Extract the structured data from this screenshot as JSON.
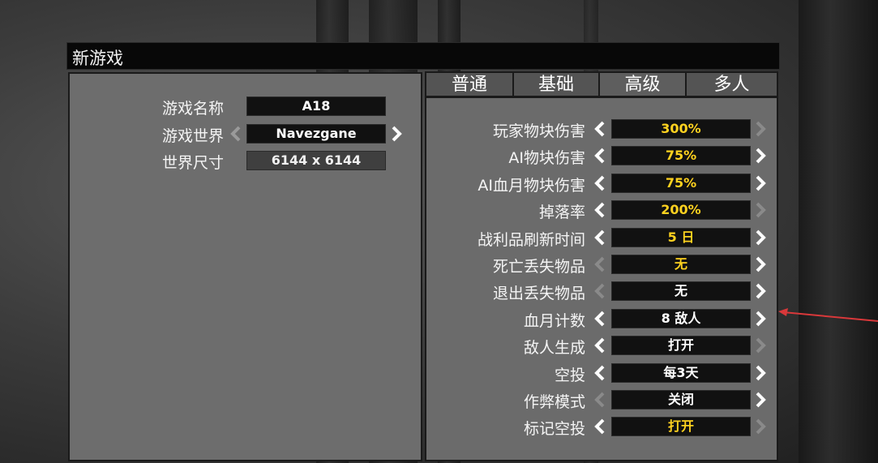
{
  "window": {
    "title": "新游戏"
  },
  "left": {
    "rows": [
      {
        "label": "游戏名称",
        "value": "A18"
      },
      {
        "label": "游戏世界",
        "value": "Navezgane"
      },
      {
        "label": "世界尺寸",
        "value": "6144 x 6144"
      }
    ]
  },
  "tabs": [
    {
      "label": "普通"
    },
    {
      "label": "基础"
    },
    {
      "label": "高级"
    },
    {
      "label": "多人"
    }
  ],
  "settings": [
    {
      "label": "玩家物块伤害",
      "value": "300%"
    },
    {
      "label": "AI物块伤害",
      "value": "75%"
    },
    {
      "label": "AI血月物块伤害",
      "value": "75%"
    },
    {
      "label": "掉落率",
      "value": "200%"
    },
    {
      "label": "战利品刷新时间",
      "value": "5 日"
    },
    {
      "label": "死亡丢失物品",
      "value": "无"
    },
    {
      "label": "退出丢失物品",
      "value": "无"
    },
    {
      "label": "血月计数",
      "value": "8 敌人"
    },
    {
      "label": "敌人生成",
      "value": "打开"
    },
    {
      "label": "空投",
      "value": "每3天"
    },
    {
      "label": "作弊模式",
      "value": "关闭"
    },
    {
      "label": "标记空投",
      "value": "打开"
    }
  ],
  "colors": {
    "highlight": "#ffd21f",
    "normal": "#ffffff",
    "annotation": "#d9383a"
  }
}
